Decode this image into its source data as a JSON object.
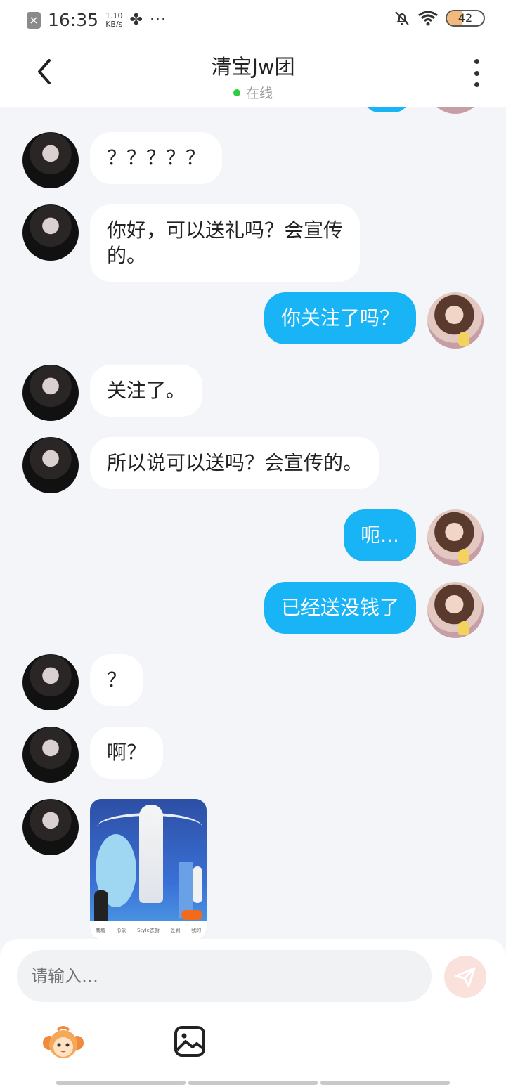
{
  "status_bar": {
    "time": "16:35",
    "speed_value": "1.10",
    "speed_unit": "KB/s",
    "dots": "···",
    "battery": "42",
    "battery_level_percent": 42,
    "icons": [
      "close-notification-icon",
      "fan-icon",
      "bell-off-icon",
      "wifi-icon",
      "battery-icon"
    ]
  },
  "header": {
    "title": "清宝Jw团",
    "status": "在线",
    "online_color": "#2ecc40"
  },
  "messages": [
    {
      "side": "in",
      "text": "？？？？？"
    },
    {
      "side": "in",
      "text": "你好，可以送礼吗？会宣传\n的。"
    },
    {
      "side": "out",
      "text": "你关注了吗？"
    },
    {
      "side": "in",
      "text": "关注了。"
    },
    {
      "side": "in",
      "text": "所以说可以送吗？会宣传的。"
    },
    {
      "side": "out",
      "text": "呃..."
    },
    {
      "side": "out",
      "text": "已经送没钱了"
    },
    {
      "side": "in",
      "text": "？"
    },
    {
      "side": "in",
      "text": "啊？"
    },
    {
      "side": "in",
      "type": "image",
      "image_tabs": [
        "商城",
        "形象",
        "Style衣橱",
        "签到",
        "我的"
      ]
    }
  ],
  "input": {
    "placeholder": "请输入…"
  },
  "colors": {
    "outgoing_bubble": "#18b4f5",
    "incoming_bubble": "#ffffff",
    "background": "#f3f5f8",
    "send_button": "#fbe1dc"
  }
}
